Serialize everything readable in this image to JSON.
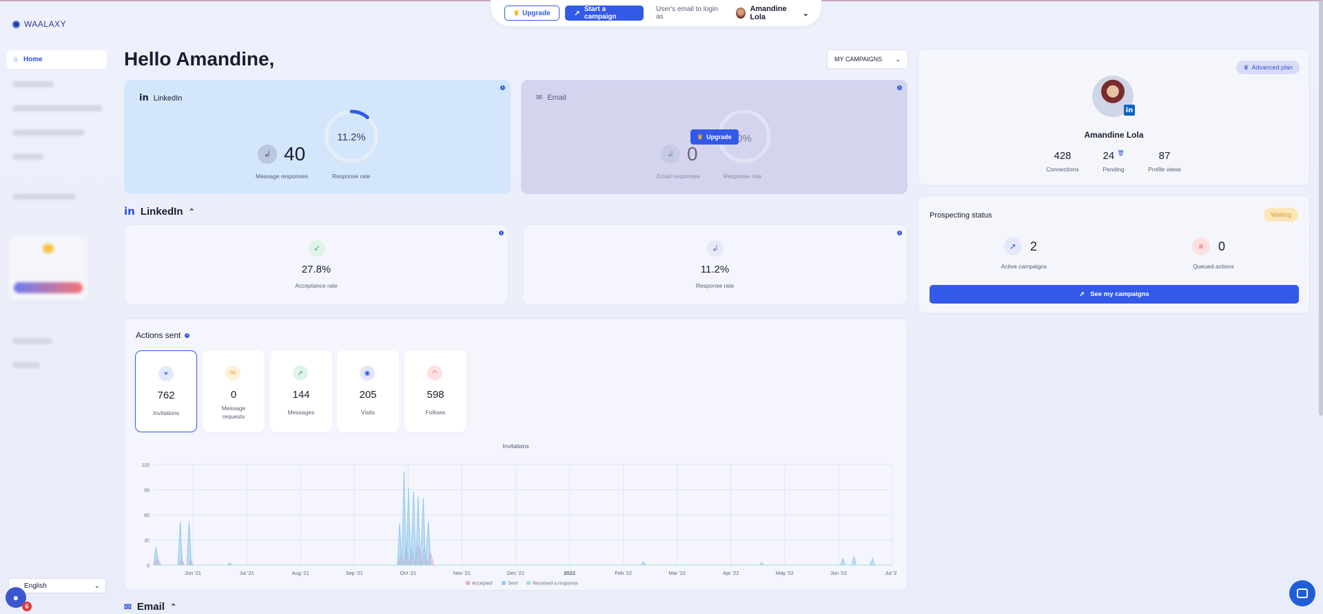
{
  "app": {
    "logo": "WAALAXY"
  },
  "topbar": {
    "upgrade_label": "Upgrade",
    "start_label": "Start a campaign",
    "email_label": "User's email to login as",
    "user_name": "Amandine Lola"
  },
  "sidebar": {
    "home_label": "Home",
    "language": "English",
    "chat_badge": "6"
  },
  "greeting": "Hello Amandine,",
  "campaign_select": "MY CAMPAIGNS",
  "linkedin_card": {
    "title": "LinkedIn",
    "message_responses": "40",
    "message_responses_label": "Message responses",
    "response_rate": "11.2%",
    "response_rate_label": "Response rate",
    "response_rate_value": 11.2
  },
  "email_card": {
    "title": "Email",
    "email_responses": "0",
    "email_responses_label": "Email responses",
    "response_rate": "0%",
    "response_rate_label": "Response rate",
    "upgrade_label": "Upgrade"
  },
  "linkedin_section": {
    "title": "LinkedIn",
    "acceptance_rate": "27.8%",
    "acceptance_rate_label": "Acceptance rate",
    "response_rate": "11.2%",
    "response_rate_label": "Response rate"
  },
  "actions": {
    "title": "Actions sent",
    "tiles": [
      {
        "value": "762",
        "label": "Invitations",
        "icon": "link-icon",
        "color": "#3259e8"
      },
      {
        "value": "0",
        "label": "Message requests",
        "icon": "envelope-icon",
        "color": "#e8a93a"
      },
      {
        "value": "144",
        "label": "Messages",
        "icon": "send-icon",
        "color": "#2fae6a"
      },
      {
        "value": "205",
        "label": "Visits",
        "icon": "eye-icon",
        "color": "#3259e8"
      },
      {
        "value": "598",
        "label": "Follows",
        "icon": "rss-icon",
        "color": "#e85a5a"
      }
    ]
  },
  "chart_data": {
    "type": "area",
    "title": "Invitations",
    "ylim": [
      0,
      120
    ],
    "yticks": [
      0,
      30,
      60,
      90,
      120
    ],
    "xticks": [
      "Jun '21",
      "Jul '21",
      "Aug '21",
      "Sep '21",
      "Oct '21",
      "Nov '21",
      "Dec '21",
      "2022",
      "Feb '22",
      "Mar '22",
      "Apr '22",
      "May '22",
      "Jun '22",
      "Jul '22"
    ],
    "grid": true,
    "legend_position": "bottom",
    "series": [
      {
        "name": "Accepted",
        "color": "#f4a6c0",
        "points": [
          [
            0.0,
            0
          ],
          [
            0.005,
            8
          ],
          [
            0.01,
            0
          ],
          [
            0.035,
            0
          ],
          [
            0.038,
            8
          ],
          [
            0.041,
            0
          ],
          [
            0.048,
            0
          ],
          [
            0.05,
            7
          ],
          [
            0.053,
            0
          ],
          [
            0.33,
            0
          ],
          [
            0.335,
            12
          ],
          [
            0.338,
            0
          ],
          [
            0.342,
            22
          ],
          [
            0.346,
            0
          ],
          [
            0.35,
            18
          ],
          [
            0.354,
            0
          ],
          [
            0.358,
            24
          ],
          [
            0.362,
            0
          ],
          [
            0.366,
            20
          ],
          [
            0.37,
            0
          ],
          [
            0.375,
            14
          ],
          [
            0.379,
            0
          ],
          [
            1.0,
            0
          ]
        ]
      },
      {
        "name": "Sent",
        "color": "#92c9ec",
        "points": [
          [
            0.0,
            0
          ],
          [
            0.003,
            22
          ],
          [
            0.007,
            0
          ],
          [
            0.033,
            0
          ],
          [
            0.036,
            52
          ],
          [
            0.039,
            0
          ],
          [
            0.045,
            0
          ],
          [
            0.048,
            52
          ],
          [
            0.051,
            0
          ],
          [
            0.1,
            0
          ],
          [
            0.103,
            3
          ],
          [
            0.106,
            0
          ],
          [
            0.33,
            0
          ],
          [
            0.333,
            50
          ],
          [
            0.336,
            0
          ],
          [
            0.339,
            112
          ],
          [
            0.342,
            0
          ],
          [
            0.345,
            92
          ],
          [
            0.348,
            0
          ],
          [
            0.352,
            88
          ],
          [
            0.355,
            0
          ],
          [
            0.358,
            82
          ],
          [
            0.361,
            0
          ],
          [
            0.365,
            80
          ],
          [
            0.368,
            0
          ],
          [
            0.372,
            52
          ],
          [
            0.375,
            0
          ],
          [
            0.66,
            0
          ],
          [
            0.663,
            4
          ],
          [
            0.666,
            0
          ],
          [
            0.82,
            0
          ],
          [
            0.823,
            3
          ],
          [
            0.826,
            0
          ],
          [
            0.93,
            0
          ],
          [
            0.933,
            8
          ],
          [
            0.936,
            0
          ],
          [
            0.945,
            0
          ],
          [
            0.948,
            10
          ],
          [
            0.951,
            0
          ],
          [
            0.97,
            0
          ],
          [
            0.973,
            8
          ],
          [
            0.976,
            0
          ],
          [
            1.0,
            0
          ]
        ]
      },
      {
        "name": "Received a response",
        "color": "#a6e0d3",
        "points": [
          [
            0.0,
            0
          ],
          [
            1.0,
            0
          ]
        ]
      }
    ]
  },
  "profile": {
    "plan": "Advanced plan",
    "name": "Amandine Lola",
    "connections": "428",
    "connections_label": "Connections",
    "pending": "24",
    "pending_label": "Pending",
    "profile_views": "87",
    "profile_views_label": "Profile views"
  },
  "prospecting": {
    "title": "Prospecting status",
    "status": "Waiting",
    "active_campaigns": "2",
    "active_campaigns_label": "Active campaigns",
    "queued_actions": "0",
    "queued_actions_label": "Queued actions",
    "button_label": "See my campaigns"
  },
  "email_section": {
    "title": "Email"
  }
}
